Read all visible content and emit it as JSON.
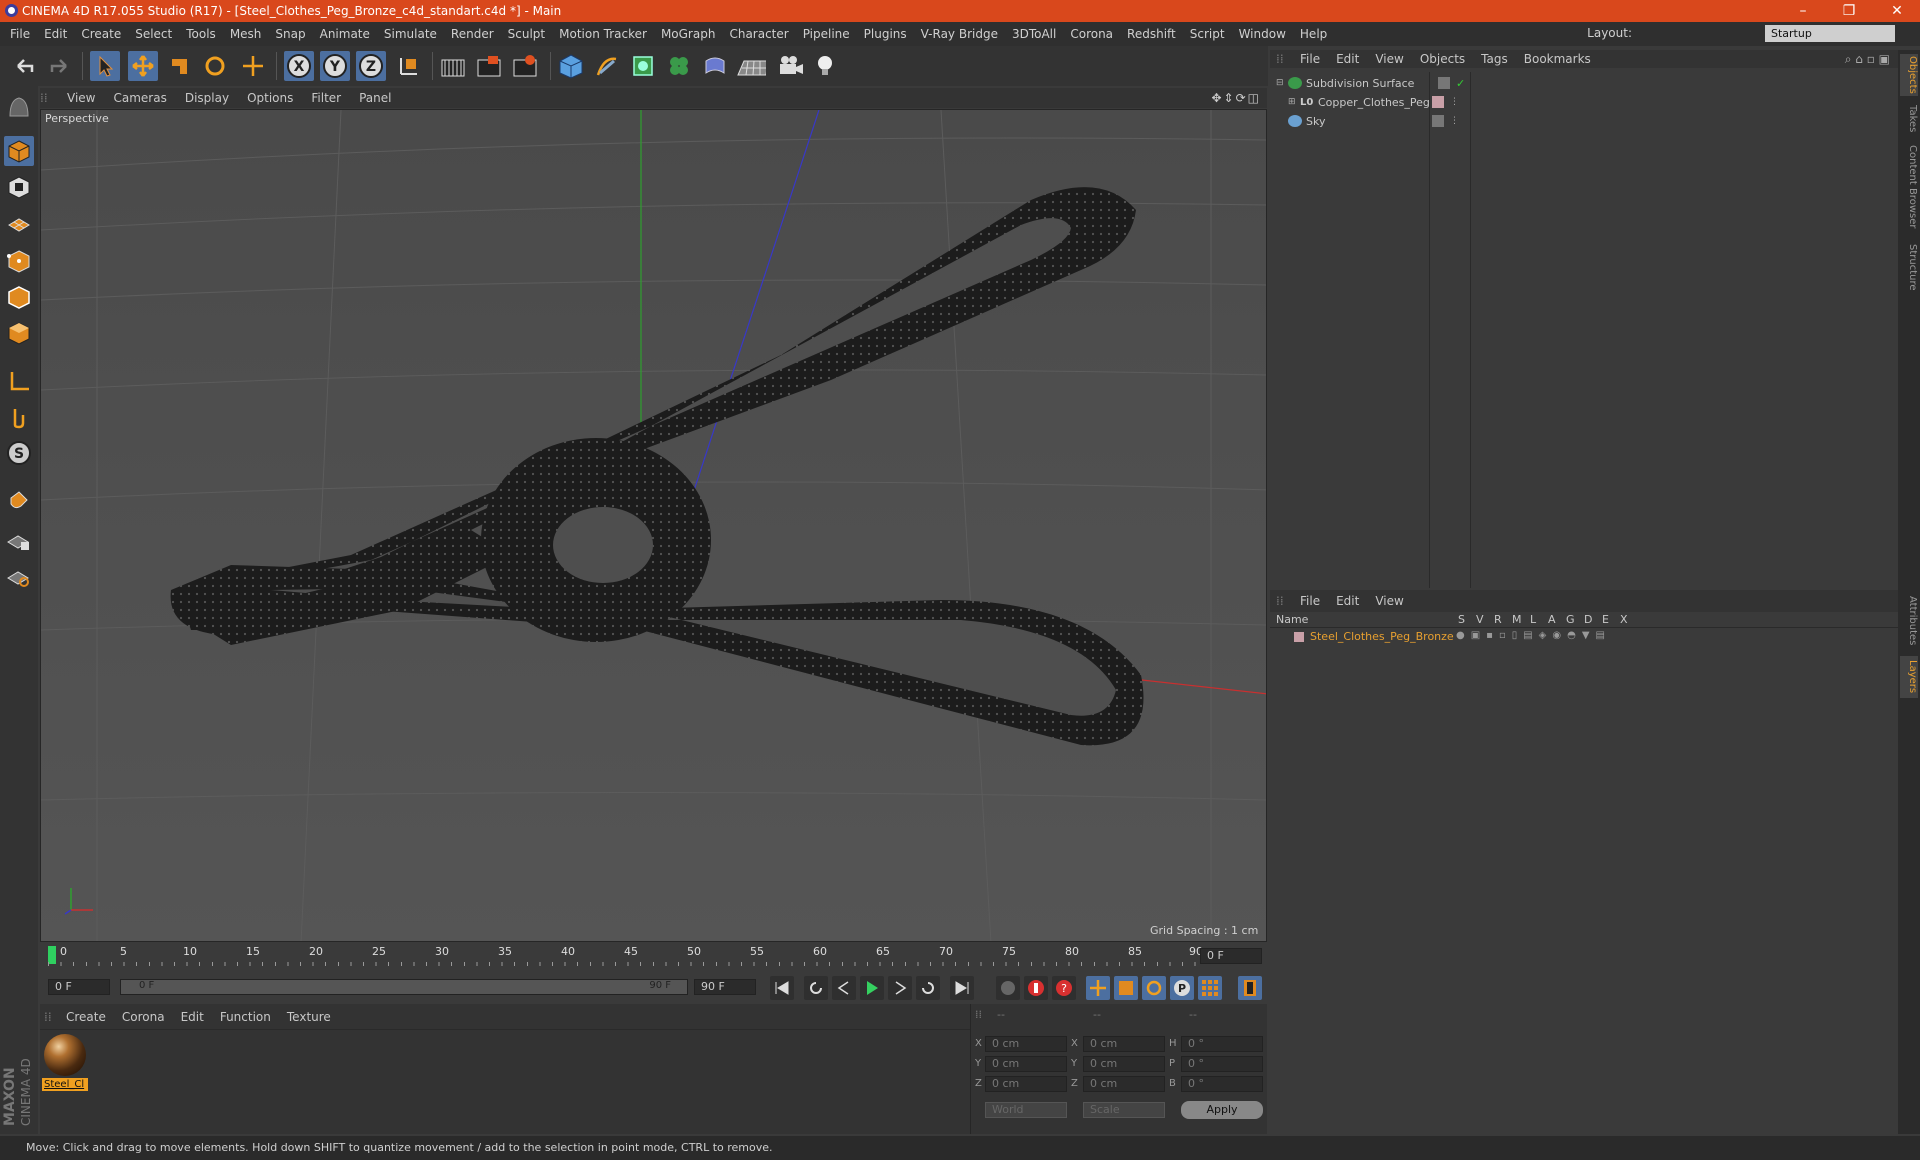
{
  "window": {
    "title": "CINEMA 4D R17.055 Studio (R17) - [Steel_Clothes_Peg_Bronze_c4d_standart.c4d *] - Main",
    "accent": "#d9481c"
  },
  "menubar": {
    "items": [
      "File",
      "Edit",
      "Create",
      "Select",
      "Tools",
      "Mesh",
      "Snap",
      "Animate",
      "Simulate",
      "Render",
      "Sculpt",
      "Motion Tracker",
      "MoGraph",
      "Character",
      "Pipeline",
      "Plugins",
      "V-Ray Bridge",
      "3DToAll",
      "Corona",
      "Redshift",
      "Script",
      "Window",
      "Help"
    ],
    "layout_label": "Layout:",
    "layout_value": "Startup"
  },
  "toolbar": {
    "icons": [
      "undo-icon",
      "redo-icon",
      "select-arrow-icon",
      "move-icon",
      "scale-icon",
      "rotate-icon",
      "last-tool-icon",
      "x-axis-icon",
      "y-axis-icon",
      "z-axis-icon",
      "coordinate-system-icon",
      "render-view-icon",
      "render-picture-viewer-icon",
      "edit-render-settings-icon",
      "cube-icon",
      "pen-icon",
      "subdivision-icon",
      "cloner-icon",
      "deformer-icon",
      "floor-icon",
      "camera-icon",
      "light-icon"
    ],
    "axis_labels": [
      "X",
      "Y",
      "Z"
    ]
  },
  "left_tools": [
    "make-editable-icon",
    "model-mode-icon",
    "texture-mode-icon",
    "workplane-icon",
    "points-mode-icon",
    "edges-mode-icon",
    "polygons-mode-icon",
    "axis-mode-icon",
    "tweak-icon",
    "snap-s-icon",
    "magnet-icon",
    "lock-grid-icon",
    "workplane-grid-icon"
  ],
  "viewport": {
    "menu": [
      "View",
      "Cameras",
      "Display",
      "Options",
      "Filter",
      "Panel"
    ],
    "label": "Perspective",
    "grid_spacing": "Grid Spacing : 1 cm"
  },
  "timeline": {
    "ticks": [
      "0",
      "5",
      "10",
      "15",
      "20",
      "25",
      "30",
      "35",
      "40",
      "45",
      "50",
      "55",
      "60",
      "65",
      "70",
      "75",
      "80",
      "85",
      "90"
    ],
    "current_frame_box": "0 F",
    "start_field": "0 F",
    "range_start": "0 F",
    "range_end": "90 F",
    "end_field": "90 F"
  },
  "material_panel": {
    "menu": [
      "Create",
      "Corona",
      "Edit",
      "Function",
      "Texture"
    ],
    "material_name": "Steel_Cl"
  },
  "brand": {
    "line1": "MAXON",
    "line2": "CINEMA 4D"
  },
  "coords": {
    "headers": [
      "--",
      "--",
      "--"
    ],
    "rows": [
      {
        "l1": "X",
        "v1": "0 cm",
        "l2": "X",
        "v2": "0 cm",
        "l3": "H",
        "v3": "0 °"
      },
      {
        "l1": "Y",
        "v1": "0 cm",
        "l2": "Y",
        "v2": "0 cm",
        "l3": "P",
        "v3": "0 °"
      },
      {
        "l1": "Z",
        "v1": "0 cm",
        "l2": "Z",
        "v2": "0 cm",
        "l3": "B",
        "v3": "0 °"
      }
    ],
    "world": "World",
    "scale": "Scale",
    "apply": "Apply"
  },
  "objects_panel": {
    "menu": [
      "File",
      "Edit",
      "View",
      "Objects",
      "Tags",
      "Bookmarks"
    ],
    "items": [
      {
        "name": "Subdivision Surface",
        "icon": "subdivision-icon"
      },
      {
        "name": "Copper_Clothes_Peg",
        "icon": "null-object-icon"
      },
      {
        "name": "Sky",
        "icon": "sky-icon"
      }
    ]
  },
  "layers_panel": {
    "menu": [
      "File",
      "Edit",
      "View"
    ],
    "columns": [
      "Name",
      "S",
      "V",
      "R",
      "M",
      "L",
      "A",
      "G",
      "D",
      "E",
      "X"
    ],
    "layer_name": "Steel_Clothes_Peg_Bronze",
    "layer_color": "#e8a030"
  },
  "right_tabs": [
    "Objects",
    "Takes",
    "Content Browser",
    "Structure",
    "Attributes",
    "Layers"
  ],
  "status": "Move: Click and drag to move elements. Hold down SHIFT to quantize movement / add to the selection in point mode, CTRL to remove."
}
